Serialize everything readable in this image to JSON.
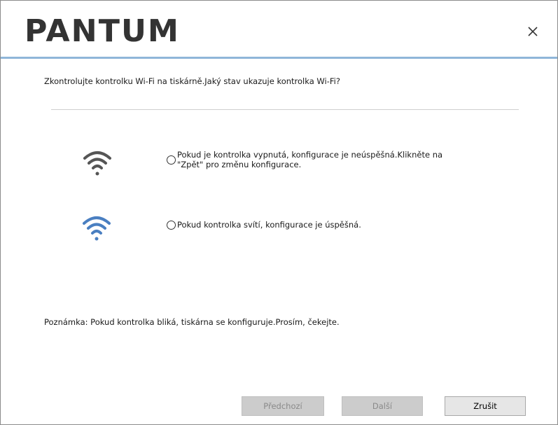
{
  "window": {
    "logo_text": "PANTUM",
    "close_symbol": "×"
  },
  "content": {
    "question": "Zkontrolujte kontrolku Wi-Fi na tiskárně.Jaký stav ukazuje kontrolka Wi-Fi?",
    "options": [
      {
        "label_line1": "Pokud je kontrolka vypnutá, konfigurace je neúspěšná.Klikněte na",
        "label_line2": "\"Zpět\" pro změnu konfigurace.",
        "icon": "wifi-off-icon",
        "icon_color": "#555555",
        "selected": false
      },
      {
        "label_line1": "Pokud kontrolka svítí, konfigurace je úspěšná.",
        "icon": "wifi-on-icon",
        "icon_color": "#4a7fc1",
        "selected": false
      }
    ],
    "note": "Poznámka: Pokud kontrolka bliká, tiskárna se konfiguruje.Prosím, čekejte."
  },
  "buttons": {
    "previous": "Předchozí",
    "next": "Další",
    "cancel": "Zrušit"
  },
  "colors": {
    "accent_line": "#8fb6d9",
    "logo": "#333333"
  }
}
